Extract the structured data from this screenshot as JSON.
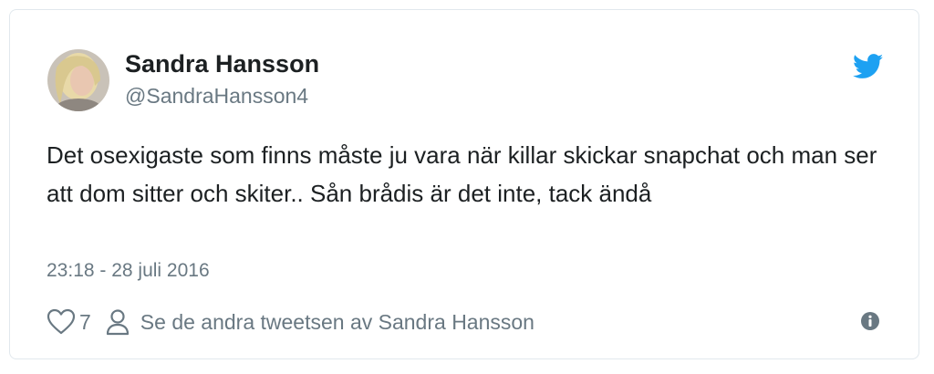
{
  "author": {
    "name": "Sandra Hansson",
    "handle": "@SandraHansson4"
  },
  "tweet": {
    "text": "Det osexigaste som finns måste ju vara när killar skickar snapchat och man ser att dom sitter och skiter.. Sån brådis är det inte, tack ändå",
    "timestamp": "23:18 - 28 juli 2016"
  },
  "actions": {
    "like_count": "7",
    "more_tweets_label": "Se de andra tweetsen av Sandra Hansson"
  },
  "icons": {
    "brand": "twitter-bird-icon",
    "like": "heart-icon",
    "profile": "person-icon",
    "info": "info-icon"
  },
  "colors": {
    "brand": "#1da1f2",
    "text": "#1c2022",
    "muted": "#697882",
    "border": "#e1e8ed"
  }
}
